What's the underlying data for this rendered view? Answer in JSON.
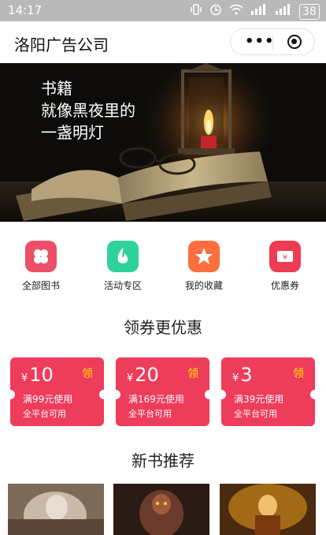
{
  "status_bar": {
    "time": "14:17",
    "battery": "38"
  },
  "header": {
    "title": "洛阳广告公司"
  },
  "banner": {
    "lines": [
      "书籍",
      "就像黑夜里的",
      "一盏明灯"
    ]
  },
  "categories": [
    {
      "label": "全部图书",
      "icon": "clover-icon",
      "color": "#ee4f68"
    },
    {
      "label": "活动专区",
      "icon": "flame-icon",
      "color": "#2fd29a"
    },
    {
      "label": "我的收藏",
      "icon": "star-icon",
      "color": "#ff6f3d"
    },
    {
      "label": "优惠券",
      "icon": "ticket-icon",
      "color": "#ef3b54"
    }
  ],
  "coupons_section": {
    "title": "领券更优惠",
    "coupons": [
      {
        "currency": "¥",
        "amount": "10",
        "claim": "领",
        "condition": "满99元使用",
        "scope": "全平台可用"
      },
      {
        "currency": "¥",
        "amount": "20",
        "claim": "领",
        "condition": "满169元使用",
        "scope": "全平台可用"
      },
      {
        "currency": "¥",
        "amount": "3",
        "claim": "领",
        "condition": "满39元使用",
        "scope": "全平台可用"
      }
    ]
  },
  "new_books_section": {
    "title": "新书推荐"
  },
  "colors": {
    "coupon": "#ee3c5b",
    "claim": "#ffe400"
  }
}
